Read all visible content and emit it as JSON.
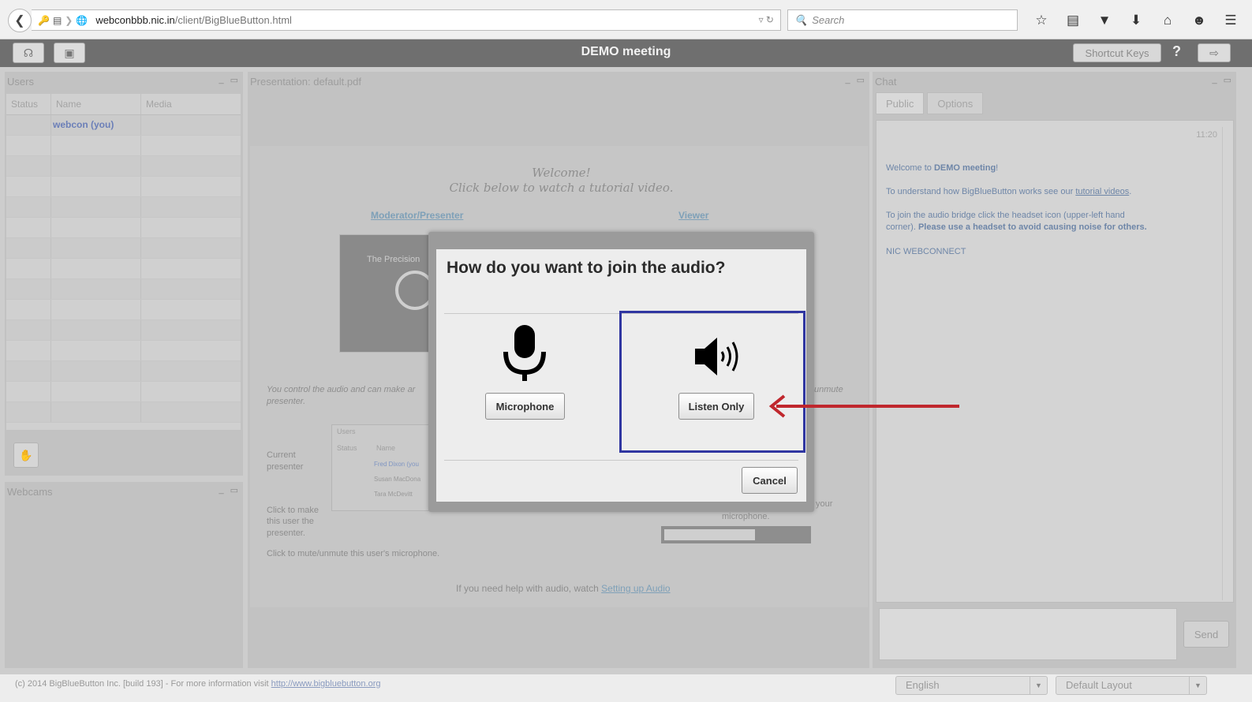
{
  "browser": {
    "url_host": "webconbbb.nic.in",
    "url_path": "/client/BigBlueButton.html",
    "search_placeholder": "Search"
  },
  "app": {
    "title": "DEMO meeting",
    "shortcut_keys_label": "Shortcut Keys",
    "help_label": "?"
  },
  "users_panel": {
    "title": "Users",
    "columns": [
      "Status",
      "Name",
      "Media"
    ],
    "rows": [
      {
        "name": "webcon (you)"
      }
    ]
  },
  "webcams_panel": {
    "title": "Webcams"
  },
  "presentation": {
    "title": "Presentation: default.pdf",
    "welcome": "Welcome!",
    "tutorial_line": "Click below to watch a tutorial video.",
    "moderator_link": "Moderator/Presenter",
    "viewer_link": "Viewer",
    "video_title": "The Precision",
    "audio_note": "You control the audio and can make ar",
    "audio_note_2": "presenter.",
    "unmute_note": "unmute",
    "current_presenter": "Current",
    "current_presenter_2": "presenter",
    "click_make": "Click to make",
    "click_make_2": "this user the",
    "click_make_3": "presenter.",
    "click_mute": "Click to mute/unmute this user's microphone.",
    "your_note": "your",
    "microphone_note": "microphone.",
    "help_prefix": "If you need help with audio, watch",
    "help_link": "Setting up Audio",
    "mini_users": "Users",
    "mini_status": "Status",
    "mini_name": "Name",
    "mini_names": [
      "Fred Dixon (you",
      "Susan MacDona",
      "Tara McDevitt"
    ]
  },
  "chat": {
    "title": "Chat",
    "tabs": [
      "Public",
      "Options"
    ],
    "time": "11:20",
    "msg1_prefix": "Welcome to",
    "msg1_bold": "DEMO meeting",
    "msg1_suffix": "!",
    "msg2_prefix": "To understand how BigBlueButton works see our",
    "msg2_link": "tutorial videos",
    "msg2_suffix": ".",
    "msg3_line1": "To join the audio bridge click the headset icon (upper-left hand",
    "msg3_line2": "corner).",
    "msg3_bold": "Please use a headset to avoid causing noise for others.",
    "msg4": "NIC WEBCONNECT",
    "send_label": "Send"
  },
  "footer": {
    "text": "(c) 2014 BigBlueButton Inc. [build 193] - For more information visit",
    "link": "http://www.bigbluebutton.org",
    "language": "English",
    "layout": "Default Layout"
  },
  "modal": {
    "title": "How do you want to join the audio?",
    "microphone_label": "Microphone",
    "listen_only_label": "Listen Only",
    "cancel_label": "Cancel"
  },
  "colors": {
    "highlight": "#3036a1",
    "arrow": "#c0272d"
  },
  "icons": [
    "back-arrow-icon",
    "key-icon",
    "page-icon",
    "globe-icon",
    "search-icon",
    "star-icon",
    "clipboard-icon",
    "pocket-icon",
    "download-icon",
    "home-icon",
    "chat-bubble-icon",
    "menu-icon",
    "headset-icon",
    "webcam-icon",
    "logout-icon",
    "microphone-icon",
    "speaker-icon"
  ]
}
